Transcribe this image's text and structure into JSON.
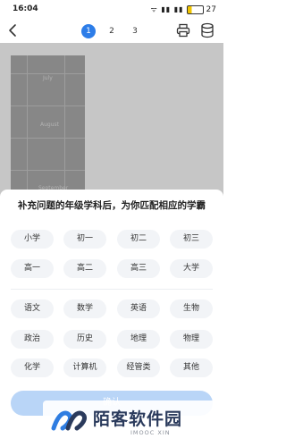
{
  "status_bar": {
    "time": "16:04",
    "icons": "ᯤ ▮▮ ▮▮",
    "battery_level": "27",
    "battery_percent": 0.27
  },
  "nav": {
    "pages": [
      "1",
      "2",
      "3"
    ],
    "active_page": "1"
  },
  "photo": {
    "words": [
      "July",
      "August",
      "September"
    ]
  },
  "sheet": {
    "title": "补充问题的年级学科后，为你匹配相应的学霸",
    "grades": [
      "小学",
      "初一",
      "初二",
      "初三",
      "高一",
      "高二",
      "高三",
      "大学"
    ],
    "subjects": [
      "语文",
      "数学",
      "英语",
      "生物",
      "政治",
      "历史",
      "地理",
      "物理",
      "化学",
      "计算机",
      "经管类",
      "其他"
    ],
    "confirm_label": "确认"
  },
  "watermark": {
    "text": "陌客软件园",
    "sub": "IMOOC XIN"
  },
  "colors": {
    "accent": "#2d7de8",
    "chip_bg": "#f2f4f7",
    "confirm_bg": "#b9d5f7"
  }
}
